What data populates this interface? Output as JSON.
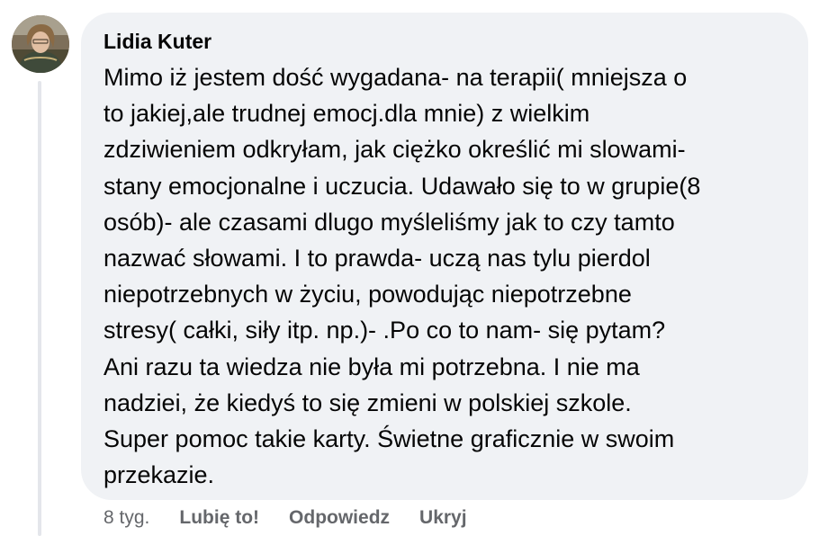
{
  "comment": {
    "author": "Lidia Kuter",
    "lines": [
      "Mimo iż jestem dość wygadana- na terapii( mniejsza o",
      "to jakiej,ale trudnej emocj.dla mnie) z wielkim",
      "zdziwieniem odkryłam, jak ciężko określić mi slowami-",
      "stany emocjonalne i uczucia. Udawało się to w grupie(8",
      "osób)- ale czasami dlugo myśleliśmy jak to czy tamto",
      "nazwać słowami. I to prawda- uczą nas tylu pierdol",
      "niepotrzebnych w życiu, powodując niepotrzebne",
      "stresy( całki, siły itp. np.)- .Po co to nam- się pytam?",
      "Ani razu ta wiedza nie była mi potrzebna. I nie ma",
      "nadziei, że kiedyś to się zmieni w polskiej szkole.",
      "Super pomoc takie karty. Świetne graficznie w swoim",
      "przekazie."
    ],
    "time": "8 tyg.",
    "actions": {
      "like": "Lubię to!",
      "reply": "Odpowiedz",
      "hide": "Ukryj"
    }
  },
  "colors": {
    "bubble": "#f0f2f5",
    "text": "#050505",
    "secondary": "#65676b",
    "thread_line": "#e4e6eb"
  },
  "icons": {
    "avatar": "profile-photo"
  }
}
